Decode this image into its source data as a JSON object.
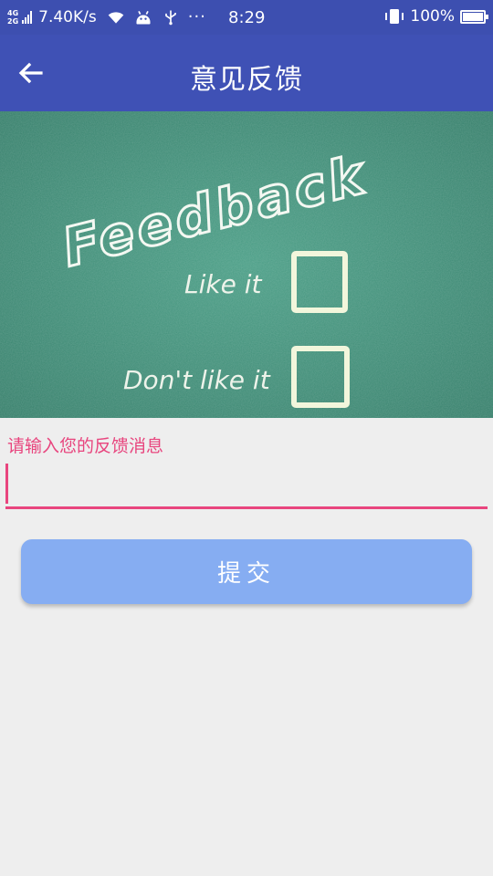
{
  "status_bar": {
    "network_top": "4G",
    "network_bottom": "2G",
    "speed": "7.40K/s",
    "more": "···",
    "time": "8:29",
    "battery_percent": "100%",
    "battery_level": 1.0,
    "icons": [
      "signal-icon",
      "wifi-icon",
      "android-icon",
      "usb-icon",
      "vibrate-icon",
      "battery-icon"
    ]
  },
  "app_bar": {
    "title": "意见反馈",
    "back_icon": "arrow-left-icon",
    "color": "#3f51b5"
  },
  "banner": {
    "heading": "Feedback",
    "option_like": "Like it",
    "option_dislike": "Don't like it",
    "background_color": "#3d8f78"
  },
  "form": {
    "hint": "请输入您的反馈消息",
    "value": "",
    "accent_color": "#e8457e"
  },
  "submit": {
    "label": "提交",
    "color": "#86adf2"
  }
}
